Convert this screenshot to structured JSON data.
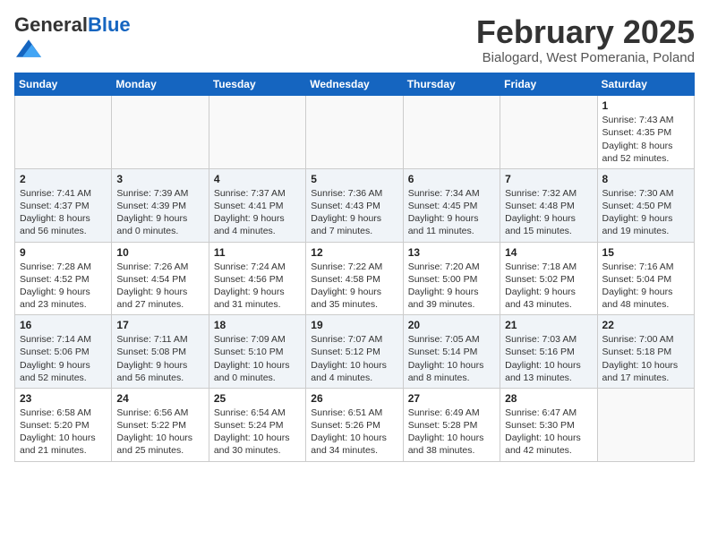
{
  "logo": {
    "general": "General",
    "blue": "Blue"
  },
  "title": "February 2025",
  "subtitle": "Bialogard, West Pomerania, Poland",
  "days_of_week": [
    "Sunday",
    "Monday",
    "Tuesday",
    "Wednesday",
    "Thursday",
    "Friday",
    "Saturday"
  ],
  "weeks": [
    [
      {
        "day": "",
        "info": ""
      },
      {
        "day": "",
        "info": ""
      },
      {
        "day": "",
        "info": ""
      },
      {
        "day": "",
        "info": ""
      },
      {
        "day": "",
        "info": ""
      },
      {
        "day": "",
        "info": ""
      },
      {
        "day": "1",
        "info": "Sunrise: 7:43 AM\nSunset: 4:35 PM\nDaylight: 8 hours and 52 minutes."
      }
    ],
    [
      {
        "day": "2",
        "info": "Sunrise: 7:41 AM\nSunset: 4:37 PM\nDaylight: 8 hours and 56 minutes."
      },
      {
        "day": "3",
        "info": "Sunrise: 7:39 AM\nSunset: 4:39 PM\nDaylight: 9 hours and 0 minutes."
      },
      {
        "day": "4",
        "info": "Sunrise: 7:37 AM\nSunset: 4:41 PM\nDaylight: 9 hours and 4 minutes."
      },
      {
        "day": "5",
        "info": "Sunrise: 7:36 AM\nSunset: 4:43 PM\nDaylight: 9 hours and 7 minutes."
      },
      {
        "day": "6",
        "info": "Sunrise: 7:34 AM\nSunset: 4:45 PM\nDaylight: 9 hours and 11 minutes."
      },
      {
        "day": "7",
        "info": "Sunrise: 7:32 AM\nSunset: 4:48 PM\nDaylight: 9 hours and 15 minutes."
      },
      {
        "day": "8",
        "info": "Sunrise: 7:30 AM\nSunset: 4:50 PM\nDaylight: 9 hours and 19 minutes."
      }
    ],
    [
      {
        "day": "9",
        "info": "Sunrise: 7:28 AM\nSunset: 4:52 PM\nDaylight: 9 hours and 23 minutes."
      },
      {
        "day": "10",
        "info": "Sunrise: 7:26 AM\nSunset: 4:54 PM\nDaylight: 9 hours and 27 minutes."
      },
      {
        "day": "11",
        "info": "Sunrise: 7:24 AM\nSunset: 4:56 PM\nDaylight: 9 hours and 31 minutes."
      },
      {
        "day": "12",
        "info": "Sunrise: 7:22 AM\nSunset: 4:58 PM\nDaylight: 9 hours and 35 minutes."
      },
      {
        "day": "13",
        "info": "Sunrise: 7:20 AM\nSunset: 5:00 PM\nDaylight: 9 hours and 39 minutes."
      },
      {
        "day": "14",
        "info": "Sunrise: 7:18 AM\nSunset: 5:02 PM\nDaylight: 9 hours and 43 minutes."
      },
      {
        "day": "15",
        "info": "Sunrise: 7:16 AM\nSunset: 5:04 PM\nDaylight: 9 hours and 48 minutes."
      }
    ],
    [
      {
        "day": "16",
        "info": "Sunrise: 7:14 AM\nSunset: 5:06 PM\nDaylight: 9 hours and 52 minutes."
      },
      {
        "day": "17",
        "info": "Sunrise: 7:11 AM\nSunset: 5:08 PM\nDaylight: 9 hours and 56 minutes."
      },
      {
        "day": "18",
        "info": "Sunrise: 7:09 AM\nSunset: 5:10 PM\nDaylight: 10 hours and 0 minutes."
      },
      {
        "day": "19",
        "info": "Sunrise: 7:07 AM\nSunset: 5:12 PM\nDaylight: 10 hours and 4 minutes."
      },
      {
        "day": "20",
        "info": "Sunrise: 7:05 AM\nSunset: 5:14 PM\nDaylight: 10 hours and 8 minutes."
      },
      {
        "day": "21",
        "info": "Sunrise: 7:03 AM\nSunset: 5:16 PM\nDaylight: 10 hours and 13 minutes."
      },
      {
        "day": "22",
        "info": "Sunrise: 7:00 AM\nSunset: 5:18 PM\nDaylight: 10 hours and 17 minutes."
      }
    ],
    [
      {
        "day": "23",
        "info": "Sunrise: 6:58 AM\nSunset: 5:20 PM\nDaylight: 10 hours and 21 minutes."
      },
      {
        "day": "24",
        "info": "Sunrise: 6:56 AM\nSunset: 5:22 PM\nDaylight: 10 hours and 25 minutes."
      },
      {
        "day": "25",
        "info": "Sunrise: 6:54 AM\nSunset: 5:24 PM\nDaylight: 10 hours and 30 minutes."
      },
      {
        "day": "26",
        "info": "Sunrise: 6:51 AM\nSunset: 5:26 PM\nDaylight: 10 hours and 34 minutes."
      },
      {
        "day": "27",
        "info": "Sunrise: 6:49 AM\nSunset: 5:28 PM\nDaylight: 10 hours and 38 minutes."
      },
      {
        "day": "28",
        "info": "Sunrise: 6:47 AM\nSunset: 5:30 PM\nDaylight: 10 hours and 42 minutes."
      },
      {
        "day": "",
        "info": ""
      }
    ]
  ]
}
